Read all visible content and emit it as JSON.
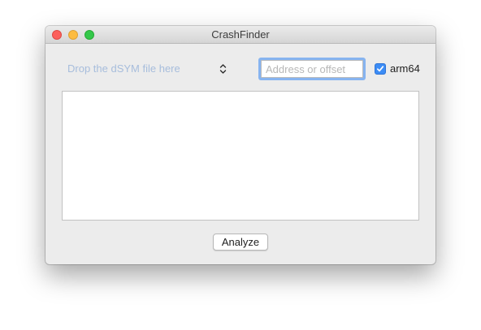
{
  "window": {
    "title": "CrashFinder"
  },
  "titlebar": {
    "close_icon": "close-icon",
    "minimize_icon": "minimize-icon",
    "zoom_icon": "zoom-icon"
  },
  "toolbar": {
    "dsym_popup_label": "Drop the dSYM file here",
    "dsym_popup_icon": "up-down-chevron-icon",
    "address_input_value": "",
    "address_input_placeholder": "Address or offset",
    "arch_checkbox_label": "arm64",
    "arch_checkbox_checked": true
  },
  "output": {
    "text": ""
  },
  "footer": {
    "analyze_label": "Analyze"
  },
  "colors": {
    "accent": "#3c8cf5",
    "focus_ring": "#87b4f0",
    "close": "#fc605c",
    "minimize": "#fdbc40",
    "zoom": "#34c84a",
    "window_background": "#ececec"
  }
}
